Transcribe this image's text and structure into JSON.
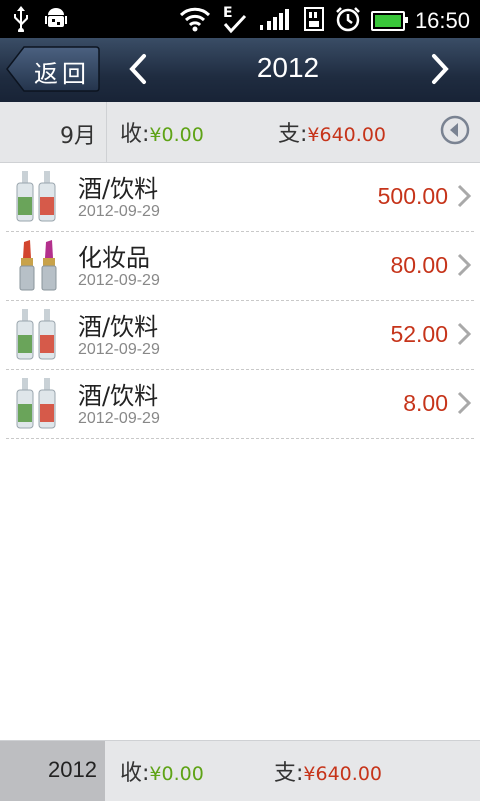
{
  "status_bar": {
    "time": "16:50",
    "icons": [
      "usb-icon",
      "android-debug-icon",
      "wifi-icon",
      "data-e-icon",
      "signal-icon",
      "sd-card-icon",
      "alarm-icon",
      "battery-icon"
    ],
    "battery_color": "#39c63a"
  },
  "titlebar": {
    "back_label": "返回",
    "year": "2012"
  },
  "month_summary": {
    "month": "9月",
    "income_label": "收:",
    "income_value": "¥0.00",
    "expense_label": "支:",
    "expense_value": "¥640.00"
  },
  "records": [
    {
      "category": "酒/饮料",
      "date": "2012-09-29",
      "amount": "500.00",
      "icon": "liquor-bottles-icon"
    },
    {
      "category": "化妆品",
      "date": "2012-09-29",
      "amount": "80.00",
      "icon": "lipstick-icon"
    },
    {
      "category": "酒/饮料",
      "date": "2012-09-29",
      "amount": "52.00",
      "icon": "liquor-bottles-icon"
    },
    {
      "category": "酒/饮料",
      "date": "2012-09-29",
      "amount": "8.00",
      "icon": "liquor-bottles-icon"
    }
  ],
  "footer": {
    "year": "2012",
    "income_label": "收:",
    "income_value": "¥0.00",
    "expense_label": "支:",
    "expense_value": "¥640.00"
  },
  "colors": {
    "income": "#5ea316",
    "expense": "#c6341a",
    "titlebar": "#1f2c40"
  }
}
